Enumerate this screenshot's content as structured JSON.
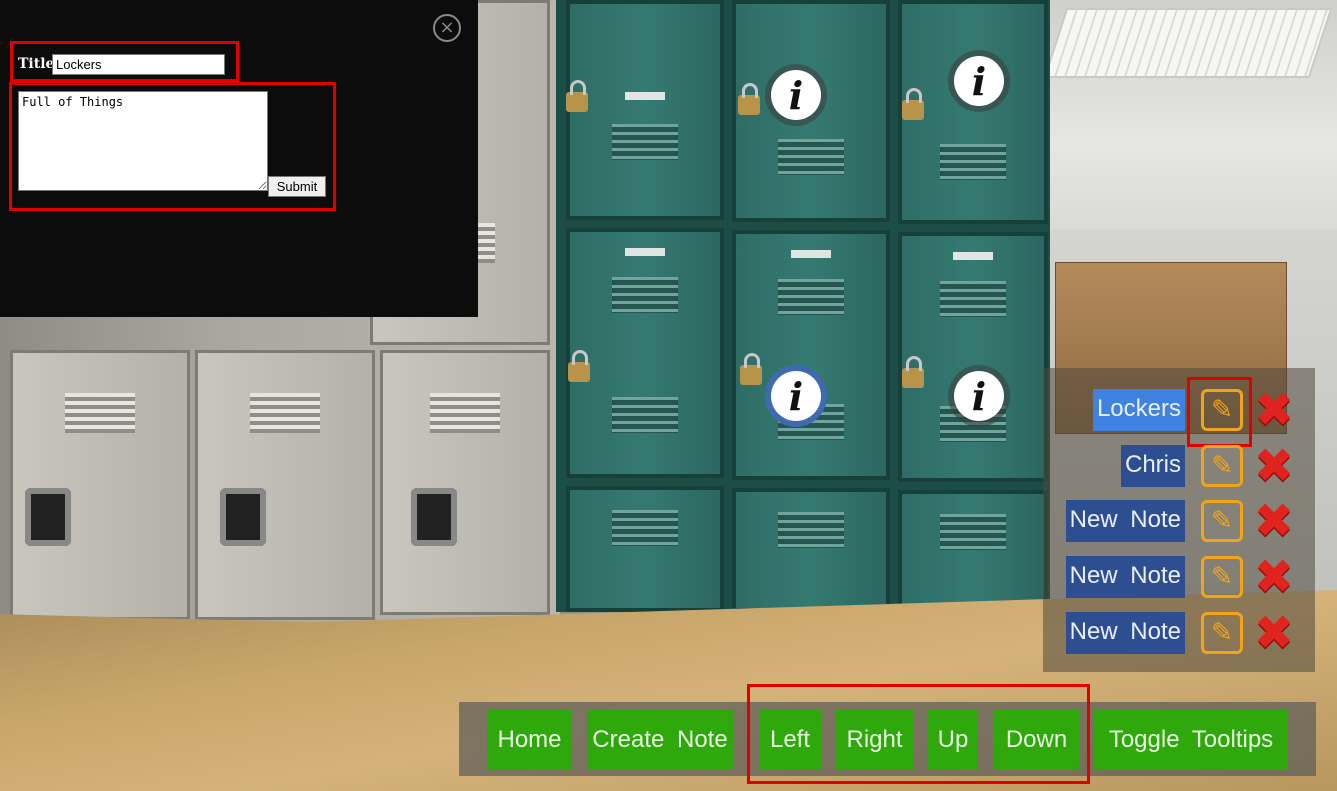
{
  "note_editor": {
    "title_label": "Title:",
    "title_value": "Lockers",
    "body_value": "Full of Things",
    "submit_label": "Submit",
    "close_icon": "close-circle-icon",
    "close_glyph": "×"
  },
  "info_markers": {
    "icon": "info-icon",
    "glyph": "i",
    "count": 4,
    "active_color": "#3f6ab0"
  },
  "notes": {
    "items": [
      {
        "label": "Lockers",
        "selected": true
      },
      {
        "label": "Chris",
        "selected": false
      },
      {
        "label": "New Note",
        "selected": false
      },
      {
        "label": "New Note",
        "selected": false
      },
      {
        "label": "New Note",
        "selected": false
      }
    ],
    "edit_icon": "pencil-edit-icon",
    "edit_glyph": "✎",
    "delete_icon": "red-x-delete-icon",
    "delete_glyph": "✖",
    "label_color": "#2d4f92",
    "selected_color": "#3f82e0"
  },
  "toolbar": {
    "home": "Home",
    "create_note": "Create Note",
    "left": "Left",
    "right": "Right",
    "up": "Up",
    "down": "Down",
    "toggle_tooltips": "Toggle Tooltips",
    "button_color": "#2ea80b"
  },
  "highlight_color": "#e00000"
}
